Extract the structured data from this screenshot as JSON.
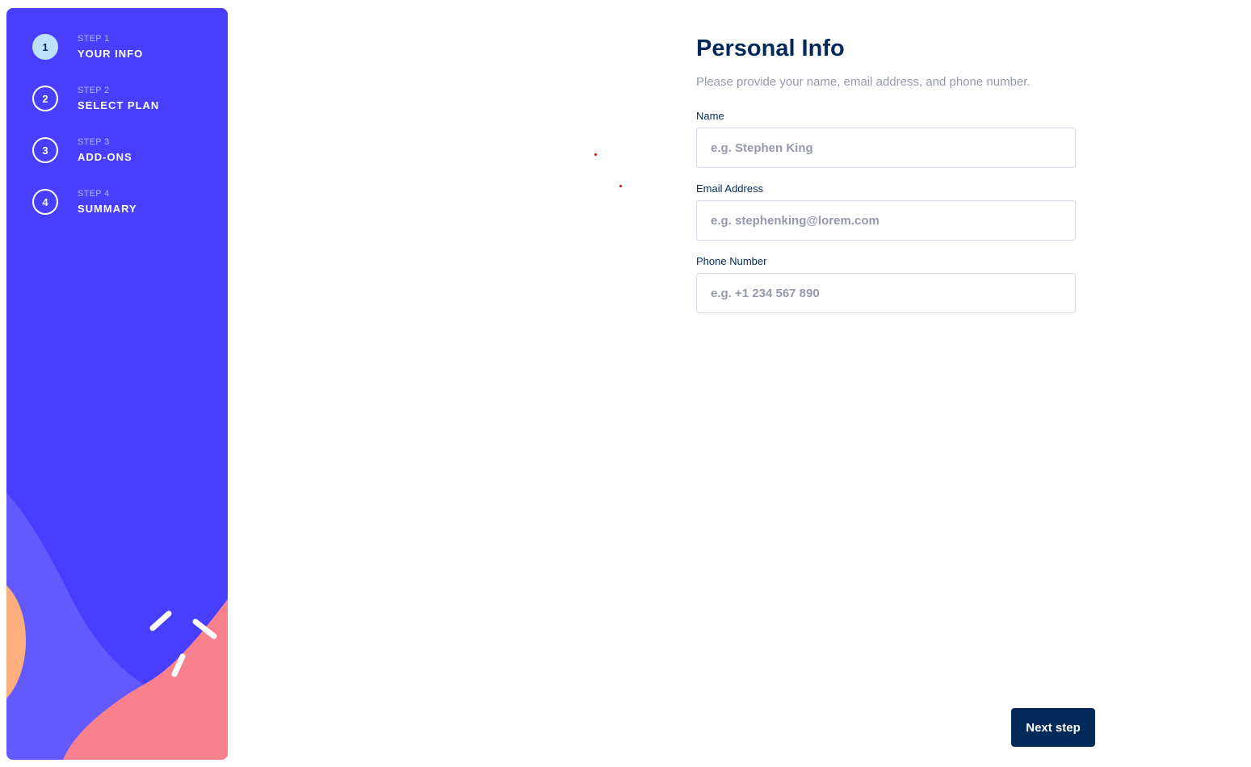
{
  "sidebar": {
    "steps": [
      {
        "number": "1",
        "kicker": "STEP 1",
        "title": "YOUR INFO",
        "active": true
      },
      {
        "number": "2",
        "kicker": "STEP 2",
        "title": "SELECT PLAN",
        "active": false
      },
      {
        "number": "3",
        "kicker": "STEP 3",
        "title": "ADD-ONS",
        "active": false
      },
      {
        "number": "4",
        "kicker": "STEP 4",
        "title": "SUMMARY",
        "active": false
      }
    ]
  },
  "main": {
    "title": "Personal Info",
    "subtitle": "Please provide your name, email address, and phone number.",
    "fields": {
      "name": {
        "label": "Name",
        "value": "",
        "placeholder": "e.g. Stephen King"
      },
      "email": {
        "label": "Email Address",
        "value": "",
        "placeholder": "e.g. stephenking@lorem.com"
      },
      "phone": {
        "label": "Phone Number",
        "value": "",
        "placeholder": "e.g. +1 234 567 890"
      }
    },
    "next_label": "Next step"
  },
  "colors": {
    "sidebar_bg": "#483eff",
    "active_step_bg": "#bee2fd",
    "primary_navy": "#02295a",
    "cool_gray": "#9699ab",
    "border": "#d6d9e6",
    "blob_purple": "#6259ff",
    "blob_pink": "#f9818e",
    "blob_orange": "#ffaf7e"
  }
}
